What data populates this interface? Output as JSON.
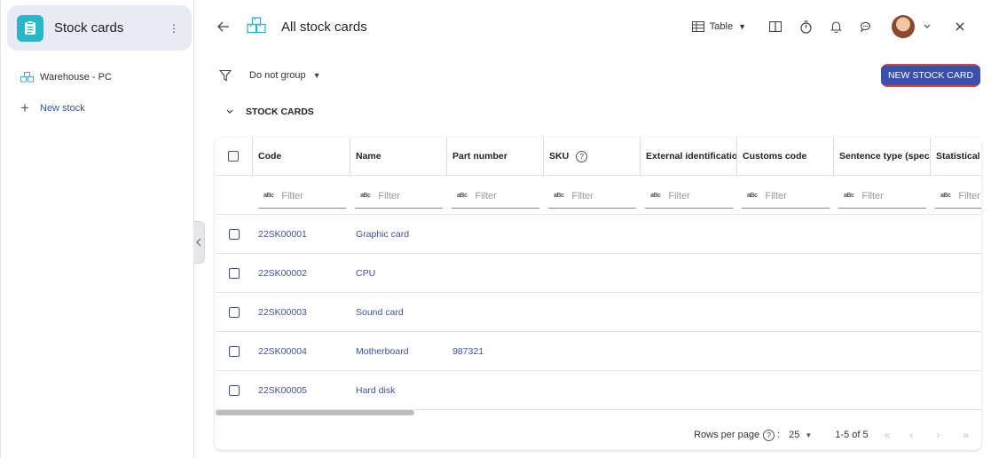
{
  "sidebar": {
    "app_title": "Stock cards",
    "items": [
      {
        "label": "Warehouse - PC"
      },
      {
        "label": "New stock"
      }
    ]
  },
  "header": {
    "title": "All stock cards",
    "view_label": "Table"
  },
  "toolbar": {
    "group_label": "Do not group",
    "new_button_label": "NEW STOCK CARD"
  },
  "section_title": "STOCK CARDS",
  "table": {
    "columns": [
      "Code",
      "Name",
      "Part number",
      "SKU",
      "External identification",
      "Customs code",
      "Sentence type (special)",
      "Statistical s"
    ],
    "filter_placeholder": "Filter",
    "filter_prefix": "aBc",
    "rows": [
      {
        "code": "22SK00001",
        "name": "Graphic card",
        "part_number": ""
      },
      {
        "code": "22SK00002",
        "name": "CPU",
        "part_number": ""
      },
      {
        "code": "22SK00003",
        "name": "Sound card",
        "part_number": ""
      },
      {
        "code": "22SK00004",
        "name": "Motherboard",
        "part_number": "987321"
      },
      {
        "code": "22SK00005",
        "name": "Hard disk",
        "part_number": ""
      }
    ]
  },
  "footer": {
    "rows_per_page_label": "Rows per page",
    "rows_per_page_value": "25",
    "range": "1-5 of 5"
  },
  "colors": {
    "accent": "#3d4fae",
    "app_icon": "#26b7c8",
    "highlight_border": "#d94040"
  }
}
